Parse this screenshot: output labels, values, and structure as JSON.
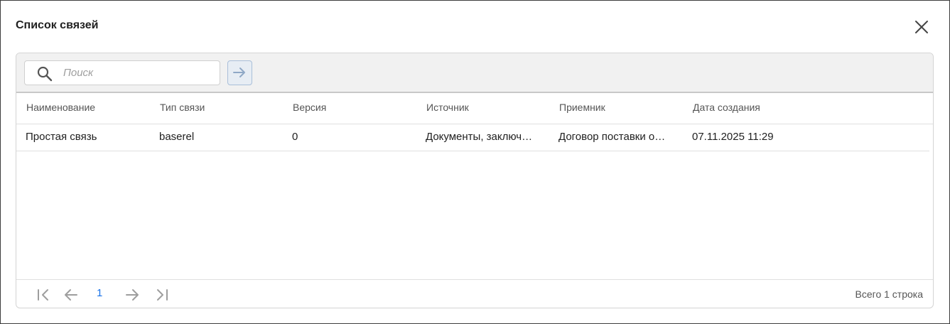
{
  "dialog": {
    "title": "Список связей"
  },
  "search": {
    "placeholder": "Поиск",
    "value": ""
  },
  "table": {
    "columns": [
      "Наименование",
      "Тип связи",
      "Версия",
      "Источник",
      "Приемник",
      "Дата создания"
    ],
    "rows": [
      [
        "Простая связь",
        "baserel",
        "0",
        "Документы, заключ…",
        "Договор поставки о…",
        "07.11.2025 11:29"
      ]
    ]
  },
  "pagination": {
    "current_page": "1",
    "total_label": "Всего 1 строка"
  },
  "colors": {
    "accent": "#1a73e8",
    "toolbar_bg": "#f1f1f1"
  }
}
